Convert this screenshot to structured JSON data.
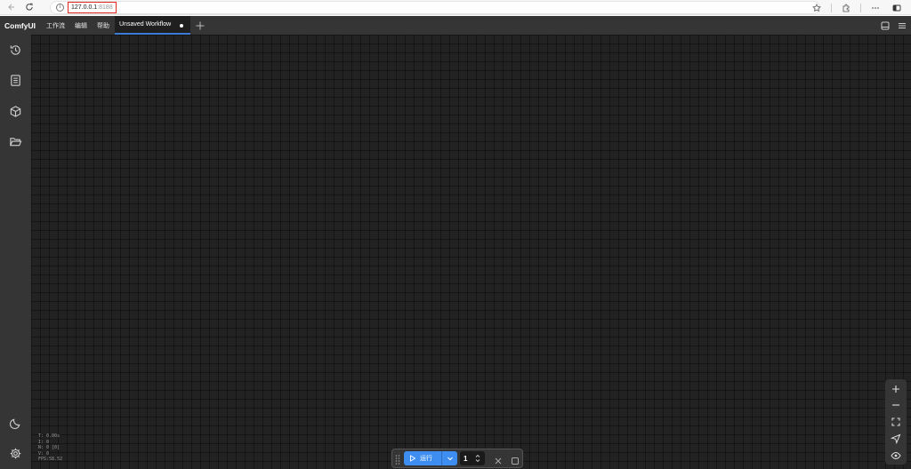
{
  "browser": {
    "url_host": "127.0.0.1",
    "url_port": ":8188",
    "icons": [
      "back-icon",
      "reload-icon",
      "info-icon",
      "star-icon",
      "extension-icon",
      "more-icon",
      "sidebar-toggle-icon"
    ]
  },
  "app": {
    "logo": "ComfyUI",
    "menu": [
      "工作流",
      "编辑",
      "帮助"
    ],
    "tab": {
      "label": "Unsaved Workflow",
      "modified": true
    },
    "top_right_icons": [
      "bottom-panel-icon",
      "hamburger-menu-icon"
    ]
  },
  "sidebar": {
    "top_icons": [
      "history-icon",
      "queue-document-icon",
      "model-cube-icon",
      "workflow-folder-icon"
    ],
    "bottom_icons": [
      "theme-moon-icon",
      "settings-gear-icon"
    ]
  },
  "canvas_stats": {
    "T": "T: 0.00s",
    "I": "I: 0",
    "N": "N: 0 [0]",
    "V": "V: 0",
    "FPS": "FPS:58.52"
  },
  "runbar": {
    "run_label": "运行",
    "batch_count": "1"
  },
  "zoom_controls": [
    "zoom-in-icon",
    "zoom-out-icon",
    "fit-view-icon",
    "locate-icon",
    "visibility-eye-icon"
  ],
  "colors": {
    "accent": "#3d8ef0",
    "tab_underline": "#3b7bd6",
    "url_highlight": "#e0281e",
    "panel": "#353535",
    "canvas": "#222222"
  }
}
